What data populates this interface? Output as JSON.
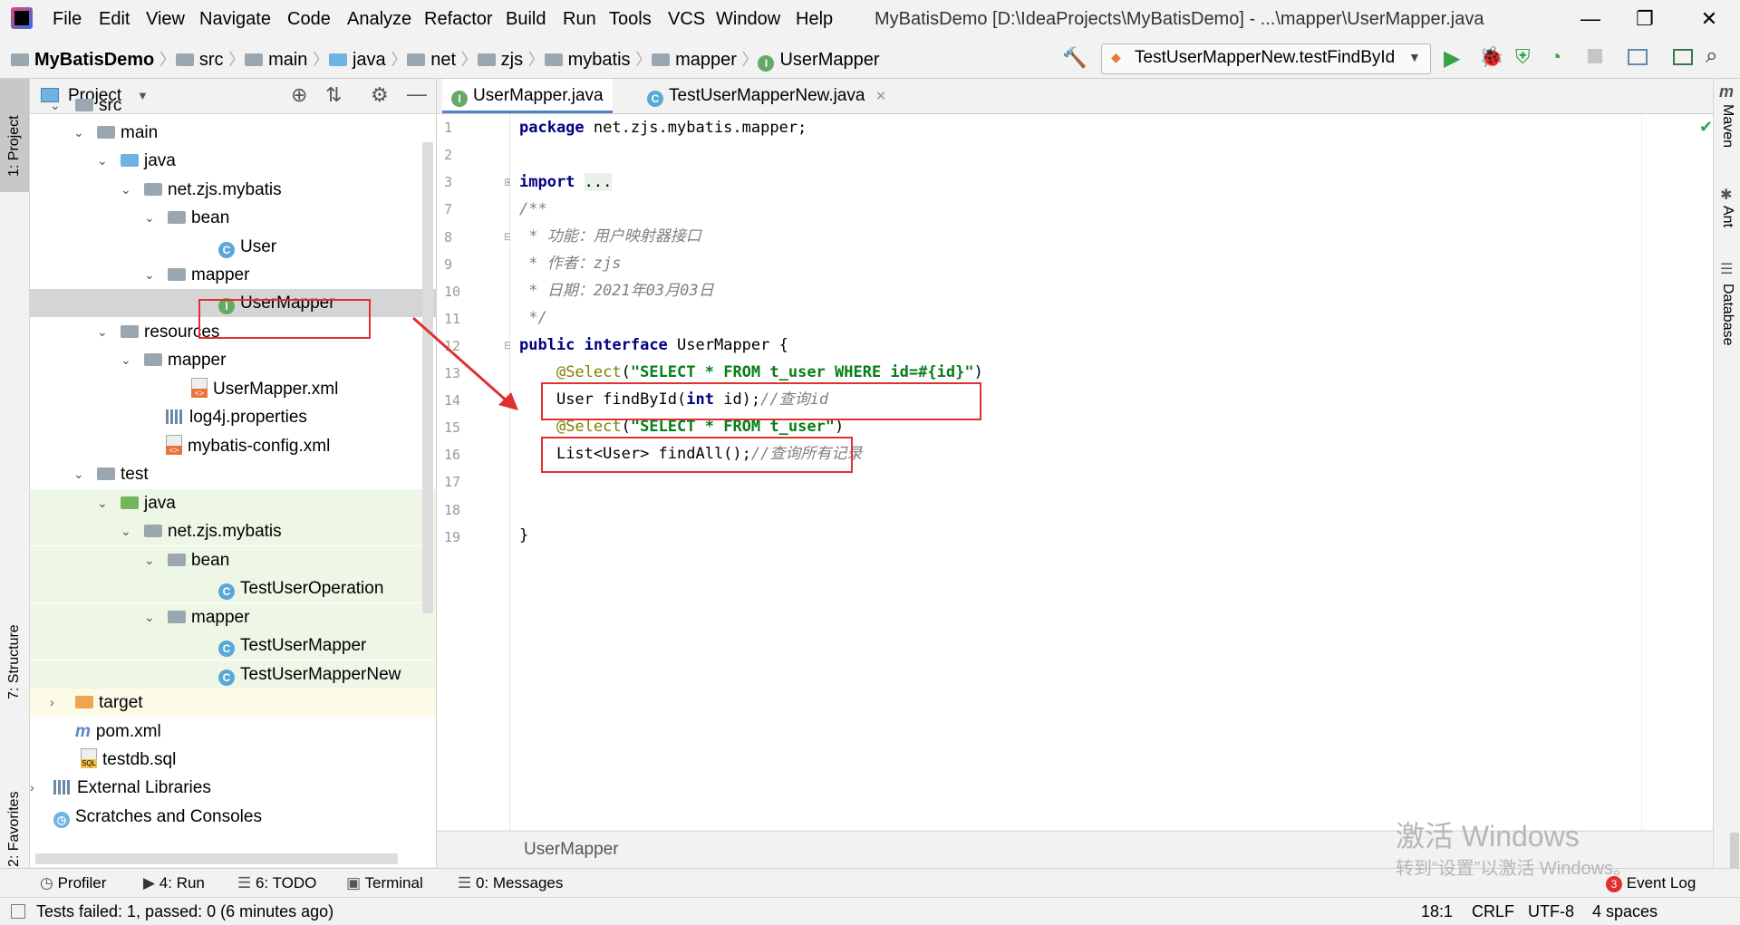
{
  "app": {
    "window_title": "MyBatisDemo [D:\\IdeaProjects\\MyBatisDemo] - ...\\mapper\\UserMapper.java",
    "menu": [
      "File",
      "Edit",
      "View",
      "Navigate",
      "Code",
      "Analyze",
      "Refactor",
      "Build",
      "Run",
      "Tools",
      "VCS",
      "Window",
      "Help"
    ]
  },
  "breadcrumb": [
    "MyBatisDemo",
    "src",
    "main",
    "java",
    "net",
    "zjs",
    "mybatis",
    "mapper",
    "UserMapper"
  ],
  "run_config": "TestUserMapperNew.testFindById",
  "left_strip": {
    "project": "1: Project",
    "structure": "7: Structure",
    "favorites": "2: Favorites"
  },
  "right_strip": {
    "maven": "Maven",
    "ant": "Ant",
    "database": "Database"
  },
  "project_panel": {
    "title": "Project",
    "tree": [
      {
        "label": "src",
        "kind": "folder"
      },
      {
        "label": "main",
        "kind": "folder"
      },
      {
        "label": "java",
        "kind": "folder-blue"
      },
      {
        "label": "net.zjs.mybatis",
        "kind": "package"
      },
      {
        "label": "bean",
        "kind": "package"
      },
      {
        "label": "User",
        "kind": "class"
      },
      {
        "label": "mapper",
        "kind": "package"
      },
      {
        "label": "UserMapper",
        "kind": "interface"
      },
      {
        "label": "resources",
        "kind": "folder"
      },
      {
        "label": "mapper",
        "kind": "package"
      },
      {
        "label": "UserMapper.xml",
        "kind": "xml"
      },
      {
        "label": "log4j.properties",
        "kind": "properties"
      },
      {
        "label": "mybatis-config.xml",
        "kind": "xml"
      },
      {
        "label": "test",
        "kind": "folder"
      },
      {
        "label": "java",
        "kind": "folder-green"
      },
      {
        "label": "net.zjs.mybatis",
        "kind": "package"
      },
      {
        "label": "bean",
        "kind": "package"
      },
      {
        "label": "TestUserOperation",
        "kind": "class"
      },
      {
        "label": "mapper",
        "kind": "package"
      },
      {
        "label": "TestUserMapper",
        "kind": "class"
      },
      {
        "label": "TestUserMapperNew",
        "kind": "class"
      },
      {
        "label": "target",
        "kind": "folder-orange"
      },
      {
        "label": "pom.xml",
        "kind": "maven"
      },
      {
        "label": "testdb.sql",
        "kind": "sql"
      },
      {
        "label": "External Libraries",
        "kind": "libs"
      },
      {
        "label": "Scratches and Consoles",
        "kind": "scratch"
      }
    ]
  },
  "editor": {
    "tabs": [
      "UserMapper.java",
      "TestUserMapperNew.java"
    ],
    "line_numbers": [
      "1",
      "2",
      "3",
      "7",
      "8",
      "9",
      "10",
      "11",
      "12",
      "13",
      "14",
      "15",
      "16",
      "17",
      "18",
      "19"
    ],
    "code": {
      "l1_kw": "package",
      "l1_rest": " net.zjs.mybatis.mapper;",
      "l3_kw": "import",
      "l3_rest": "...",
      "l8": "/**",
      "l9": " * 功能：用户映射器接口",
      "l10": " * 作者：zjs",
      "l11": " * 日期：2021年03月03日",
      "l12": " */",
      "l13_kw1": "public",
      "l13_kw2": "interface",
      "l13_rest": " UserMapper {",
      "l14_ann": "@Select",
      "l14_str": "\"SELECT * FROM t_user WHERE id=#{id}\"",
      "l15_pre": "User findById(",
      "l15_kw": "int",
      "l15_post": " id);",
      "l15_cmt": "//查询id",
      "l16_ann": "@Select",
      "l16_str": "\"SELECT * FROM t_user\"",
      "l17_pre": "List<User> findAll();",
      "l17_cmt": "//查询所有记录",
      "l19": "}"
    },
    "footer_crumb": "UserMapper"
  },
  "bottom_tools": [
    "Profiler",
    "4: Run",
    "6: TODO",
    "Terminal",
    "0: Messages"
  ],
  "event_log": {
    "badge": "3",
    "label": "Event Log"
  },
  "status": {
    "message": "Tests failed: 1, passed: 0 (6 minutes ago)",
    "position": "18:1",
    "line_sep": "CRLF",
    "encoding": "UTF-8",
    "indent": "4 spaces"
  },
  "watermark": {
    "line1": "激活 Windows",
    "line2": "转到“设置”以激活 Windows。"
  }
}
